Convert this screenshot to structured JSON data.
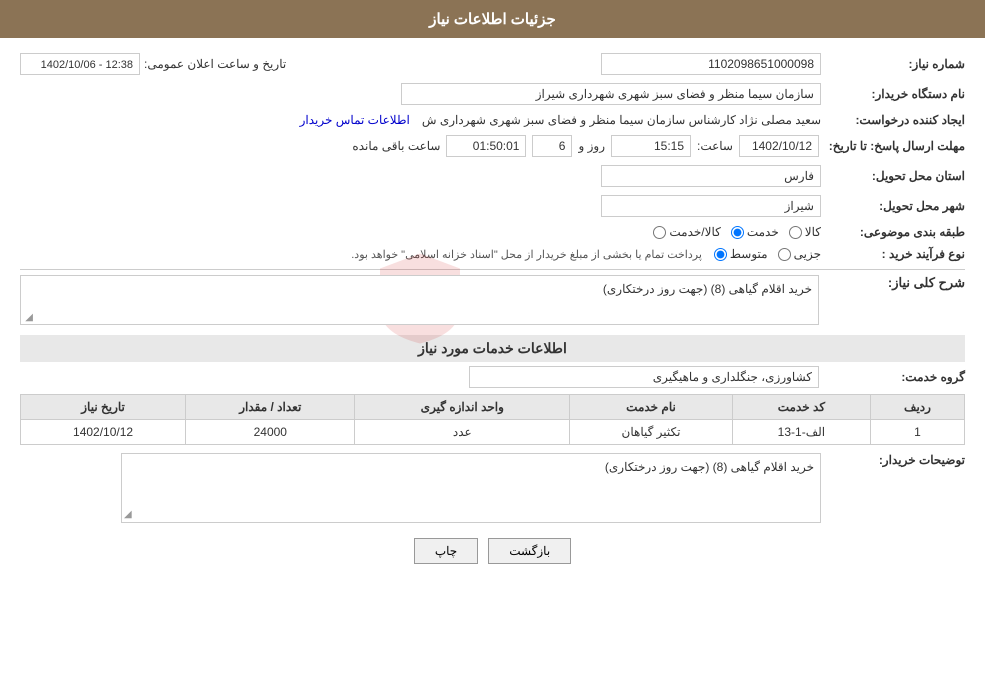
{
  "header": {
    "title": "جزئیات اطلاعات نیاز"
  },
  "fields": {
    "need_number_label": "شماره نیاز:",
    "need_number_value": "1102098651000098",
    "buyer_org_label": "نام دستگاه خریدار:",
    "buyer_org_value": "سازمان سیما منظر و فضای سبز شهری شهرداری شیراز",
    "creator_label": "ایجاد کننده درخواست:",
    "creator_value": "سعید مصلی نژاد کارشناس سازمان سیما منظر و فضای سبز شهری شهرداری ش",
    "creator_link": "اطلاعات تماس خریدار",
    "deadline_label": "مهلت ارسال پاسخ: تا تاریخ:",
    "deadline_date": "1402/10/12",
    "deadline_time_label": "ساعت:",
    "deadline_time": "15:15",
    "deadline_days_label": "روز و",
    "deadline_days": "6",
    "deadline_remaining_label": "ساعت باقی مانده",
    "deadline_remaining": "01:50:01",
    "province_label": "استان محل تحویل:",
    "province_value": "فارس",
    "city_label": "شهر محل تحویل:",
    "city_value": "شیراز",
    "category_label": "طبقه بندی موضوعی:",
    "category_options": [
      {
        "id": "kala",
        "label": "کالا"
      },
      {
        "id": "khadamat",
        "label": "خدمت"
      },
      {
        "id": "kala_khadamat",
        "label": "کالا/خدمت"
      }
    ],
    "category_selected": "khadamat",
    "purchase_type_label": "نوع فرآیند خرید :",
    "purchase_options": [
      {
        "id": "jozvi",
        "label": "جزیی"
      },
      {
        "id": "motavasset",
        "label": "متوسط"
      }
    ],
    "purchase_selected": "motavasset",
    "purchase_note": "پرداخت تمام یا بخشی از مبلغ خریدار از محل \"اسناد خزانه اسلامی\" خواهد بود.",
    "announce_label": "تاریخ و ساعت اعلان عمومی:",
    "announce_value": "1402/10/06 - 12:38"
  },
  "description": {
    "section_label": "شرح کلی نیاز:",
    "text": "خرید اقلام گیاهی  (8) (جهت روز درختکاری)"
  },
  "services_section": {
    "title": "اطلاعات خدمات مورد نیاز",
    "group_label": "گروه خدمت:",
    "group_value": "کشاورزی، جنگلداری و ماهیگیری",
    "table": {
      "columns": [
        "ردیف",
        "کد خدمت",
        "نام خدمت",
        "واحد اندازه گیری",
        "تعداد / مقدار",
        "تاریخ نیاز"
      ],
      "rows": [
        {
          "row_num": "1",
          "service_code": "الف-1-13",
          "service_name": "تکثیر گیاهان",
          "unit": "عدد",
          "quantity": "24000",
          "date": "1402/10/12"
        }
      ]
    }
  },
  "buyer_description": {
    "label": "توضیحات خریدار:",
    "text": "خرید اقلام گیاهی  (8) (جهت روز درختکاری)"
  },
  "buttons": {
    "print": "چاپ",
    "back": "بازگشت"
  }
}
